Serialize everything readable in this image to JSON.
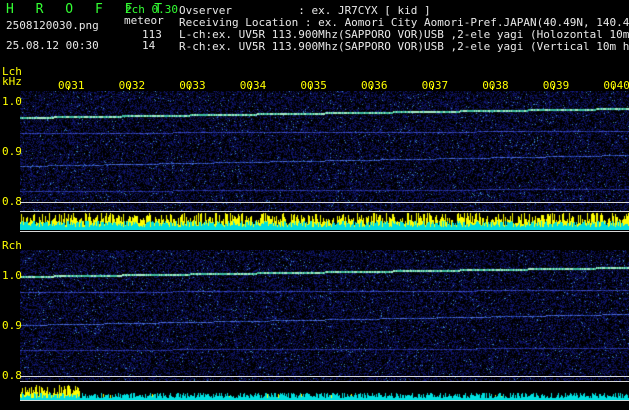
{
  "header": {
    "title": "H R O F F T",
    "mode": "2ch 0.30",
    "filename": "2508120030.png",
    "meteor_label": "meteor",
    "lch_count": "113",
    "rch_count": "14",
    "datetime": "25.08.12 00:30",
    "observer": "Ovserver          : ex. JR7CYX [ kid ]",
    "location": "Receiving Location : ex. Aomori City Aomori-Pref.JAPAN(40.49N, 140.47E)",
    "lch_info": "L-ch:ex. UV5R 113.900Mhz(SAPPORO VOR)USB ,2-ele yagi (Holozontal 10m height)",
    "rch_info": "R-ch:ex. UV5R 113.900Mhz(SAPPORO VOR)USB ,2-ele yagi (Vertical 10m height)"
  },
  "lch": {
    "label": "Lch",
    "unit": "kHz",
    "y_labels": [
      "1.0",
      "0.9",
      "0.8"
    ]
  },
  "rch": {
    "label": "Rch",
    "y_labels": [
      "1.0",
      "0.9",
      "0.8"
    ]
  },
  "time_ticks": [
    "0031",
    "0032",
    "0033",
    "0034",
    "0035",
    "0036",
    "0037",
    "0038",
    "0039",
    "0040"
  ],
  "colors": {
    "text_green": "#33ff33",
    "text_white": "#e8e8e8",
    "axis_yellow": "#ffff00",
    "background_noise": "#0a0a5a",
    "level_yellow": "#ffff00",
    "level_cyan": "#00e0e0"
  }
}
